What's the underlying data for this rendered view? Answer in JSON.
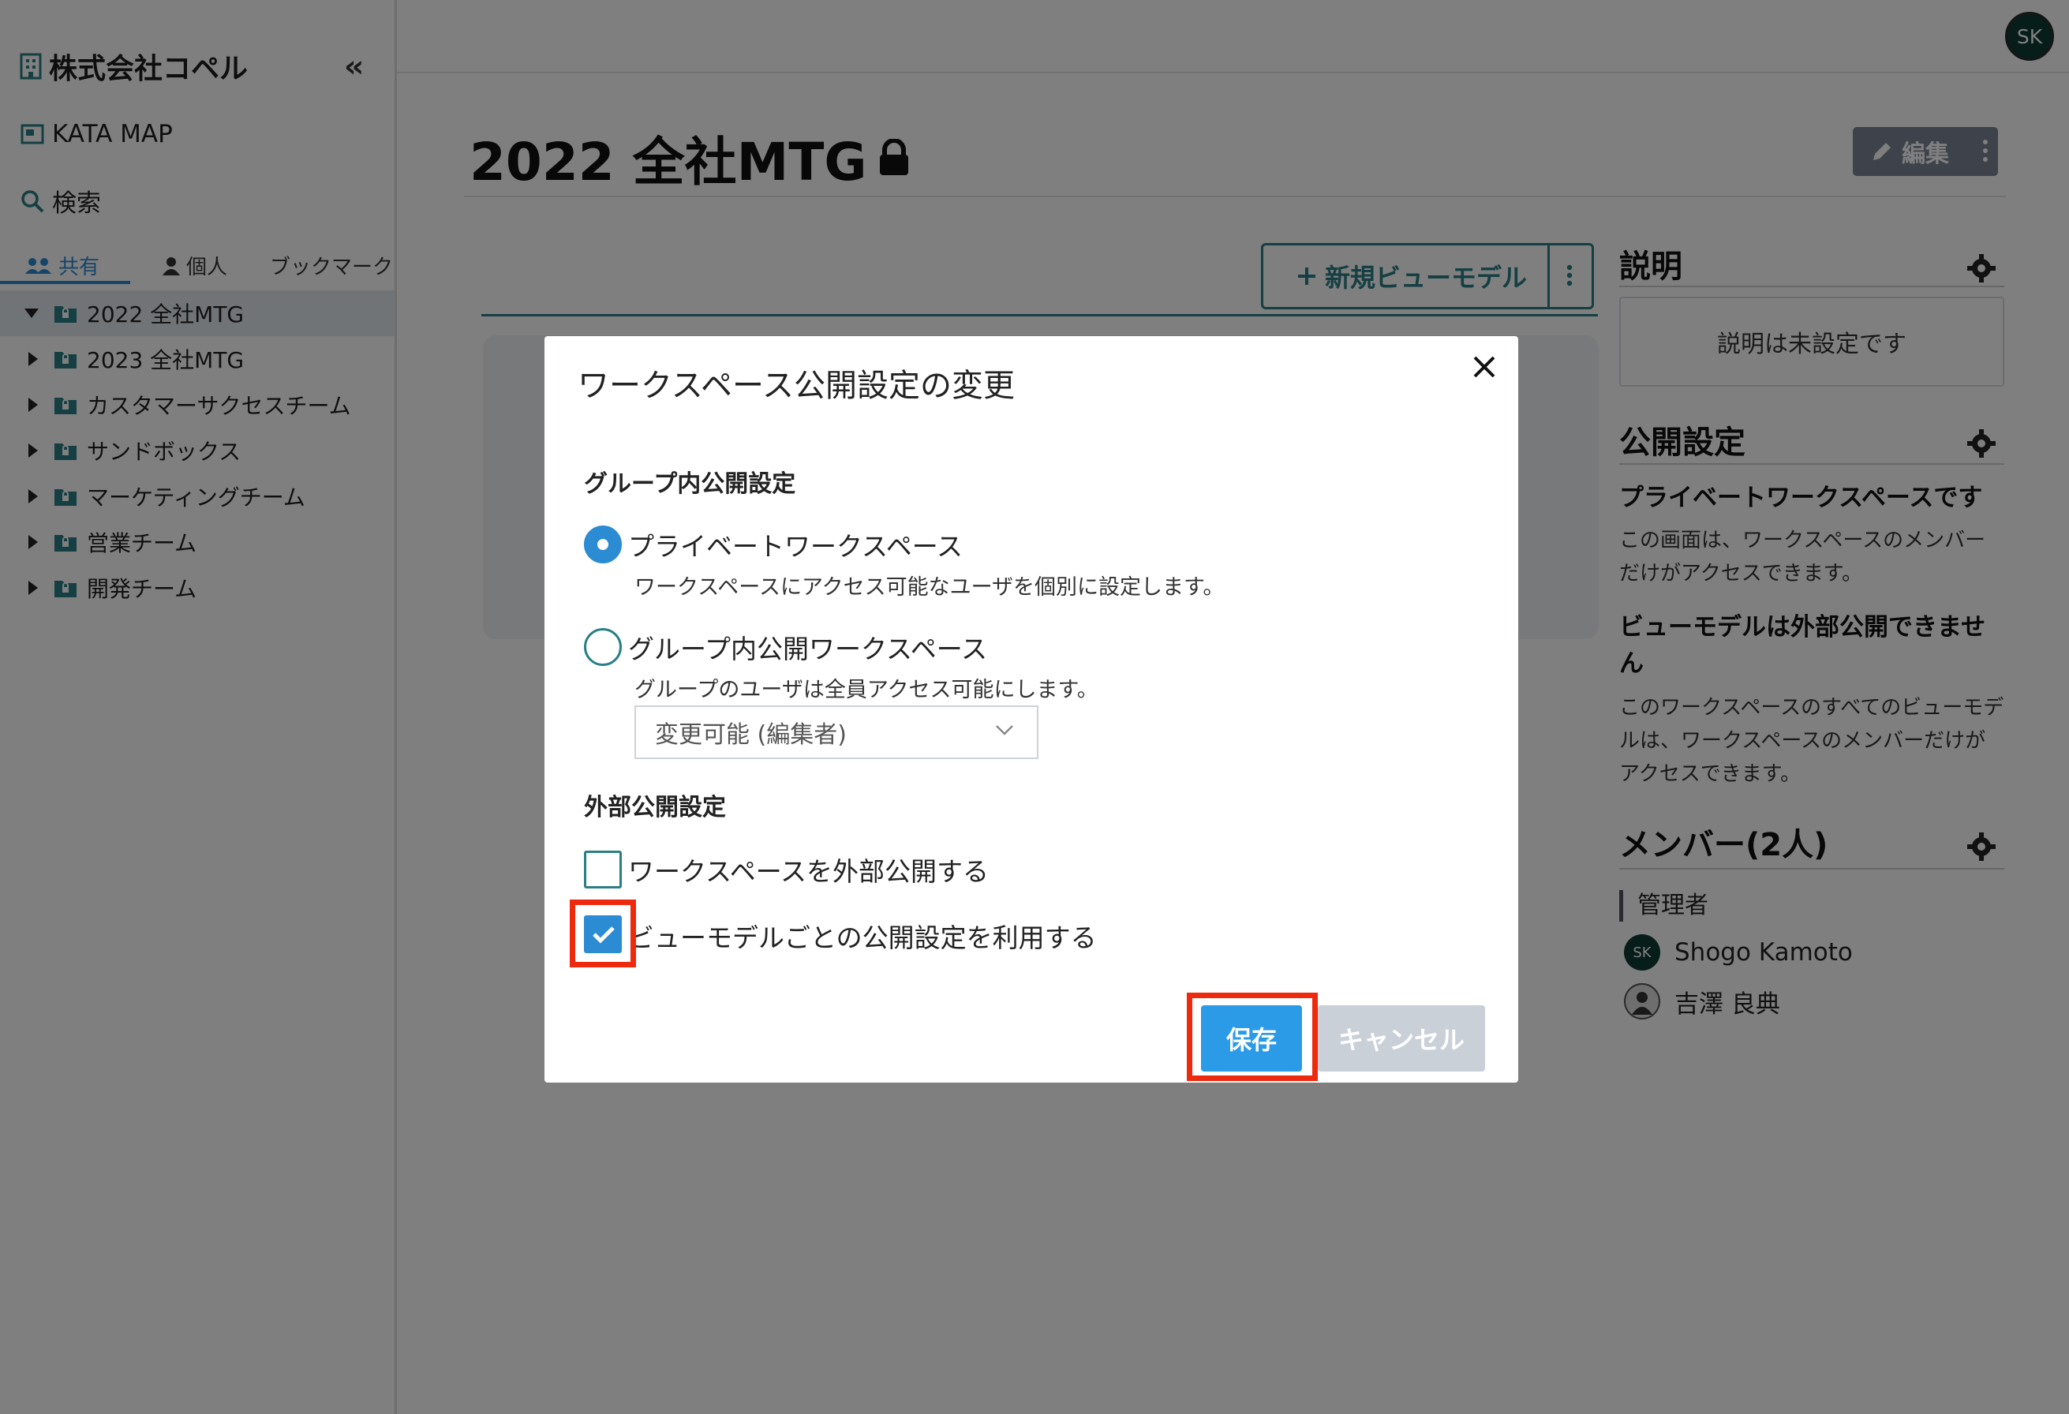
{
  "sidebar": {
    "org_name": "株式会社コペル",
    "links": {
      "katamap": "KATA MAP",
      "search": "検索"
    },
    "tabs": {
      "shared": "共有",
      "personal": "個人",
      "bookmark": "ブックマーク"
    },
    "tree": [
      {
        "label": "2022 全社MTG",
        "expanded": true,
        "selected": true
      },
      {
        "label": "2023 全社MTG"
      },
      {
        "label": "カスタマーサクセスチーム"
      },
      {
        "label": "サンドボックス"
      },
      {
        "label": "マーケティングチーム"
      },
      {
        "label": "営業チーム"
      },
      {
        "label": "開発チーム"
      }
    ]
  },
  "header": {
    "avatar_initials": "SK"
  },
  "page": {
    "title": "2022 全社MTG",
    "edit_label": "編集",
    "new_viewmodel_label": "新規ビューモデル"
  },
  "right_panel": {
    "description_title": "説明",
    "description_empty": "説明は未設定です",
    "publish_title": "公開設定",
    "private_heading": "プライベートワークスペースです",
    "private_text": "この画面は、ワークスペースのメンバーだけがアクセスできます。",
    "vm_heading": "ビューモデルは外部公開できません",
    "vm_text": "このワークスペースのすべてのビューモデルは、ワークスペースのメンバーだけがアクセスできます。",
    "members_title": "メンバー(2人)",
    "role_label": "管理者",
    "members": [
      {
        "name": "Shogo Kamoto",
        "initials": "SK"
      },
      {
        "name": "吉澤 良典"
      }
    ]
  },
  "modal": {
    "title": "ワークスペース公開設定の変更",
    "group_section": "グループ内公開設定",
    "option_private": "プライベートワークスペース",
    "option_private_hint": "ワークスペースにアクセス可能なユーザを個別に設定します。",
    "option_group": "グループ内公開ワークスペース",
    "option_group_hint": "グループのユーザは全員アクセス可能にします。",
    "select_value": "変更可能 (編集者)",
    "external_section": "外部公開設定",
    "check_external": "ワークスペースを外部公開する",
    "check_per_vm": "ビューモデルごとの公開設定を利用する",
    "save_label": "保存",
    "cancel_label": "キャンセル",
    "selected_option": "private",
    "check_external_checked": false,
    "check_per_vm_checked": true
  },
  "colors": {
    "accent": "#2b8bd3",
    "teal": "#2a7f86",
    "highlight": "#ee2a0e"
  }
}
